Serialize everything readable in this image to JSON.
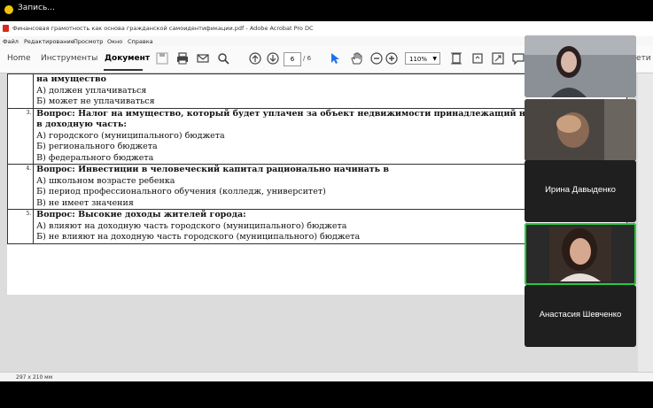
{
  "recording": {
    "label": "Запись..."
  },
  "window": {
    "title": "Финансовая грамотность как основа гражданской самоидентификации.pdf - Adobe Acrobat Pro DC"
  },
  "menu": {
    "items": [
      "Файл",
      "Редактирование",
      "Просмотр",
      "Окно",
      "Справка"
    ]
  },
  "toolbar": {
    "tabs": [
      "Home",
      "Инструменты",
      "Документ"
    ],
    "active_tab": "Документ",
    "page_current": "6",
    "page_total": "/ 6",
    "zoom": "110%",
    "right_tab_partial": "ети"
  },
  "document": {
    "rows": [
      {
        "num": "",
        "lines": [
          {
            "text": "на имущество",
            "bold": true
          },
          {
            "text": "А) должен уплачиваться"
          },
          {
            "text": "Б) может не уплачиваться"
          }
        ]
      },
      {
        "num": "3.",
        "lines": [
          {
            "text": "Вопрос: Налог на имущество, который будет уплачен за объект недвижимости принадлежащий несовершенно",
            "bold": true
          },
          {
            "text": "в доходную часть:",
            "bold": true
          },
          {
            "text": "А) городского (муниципального) бюджета"
          },
          {
            "text": "Б) регионального бюджета"
          },
          {
            "text": "В) федерального бюджета"
          }
        ]
      },
      {
        "num": "4.",
        "lines": [
          {
            "text": "Вопрос: Инвестиции в человеческий капитал рационально начинать в",
            "bold": true
          },
          {
            "text": "А) школьном возрасте ребенка"
          },
          {
            "text": "Б) период профессионального обучения (колледж, университет)"
          },
          {
            "text": "В) не имеет значения"
          }
        ]
      },
      {
        "num": "5.",
        "lines": [
          {
            "text": "Вопрос: Высокие доходы жителей города:",
            "bold": true
          },
          {
            "text": "А) влияют на доходную часть городского (муниципального) бюджета"
          },
          {
            "text": "Б) не влияют на доходную часть городского (муниципального) бюджета"
          }
        ]
      }
    ]
  },
  "status": {
    "page_size": "297 x 210 мм"
  },
  "participants": [
    {
      "name": "",
      "video": true
    },
    {
      "name": "",
      "video": true
    },
    {
      "name": "Ирина Давыденко",
      "video": false
    },
    {
      "name": "",
      "video": true,
      "speaking": true
    },
    {
      "name": "Анастасия Шевченко",
      "video": false
    }
  ],
  "colors": {
    "speaking_border": "#27c93f",
    "acrobat_red": "#d9291c",
    "tab_underline": "#333333"
  }
}
